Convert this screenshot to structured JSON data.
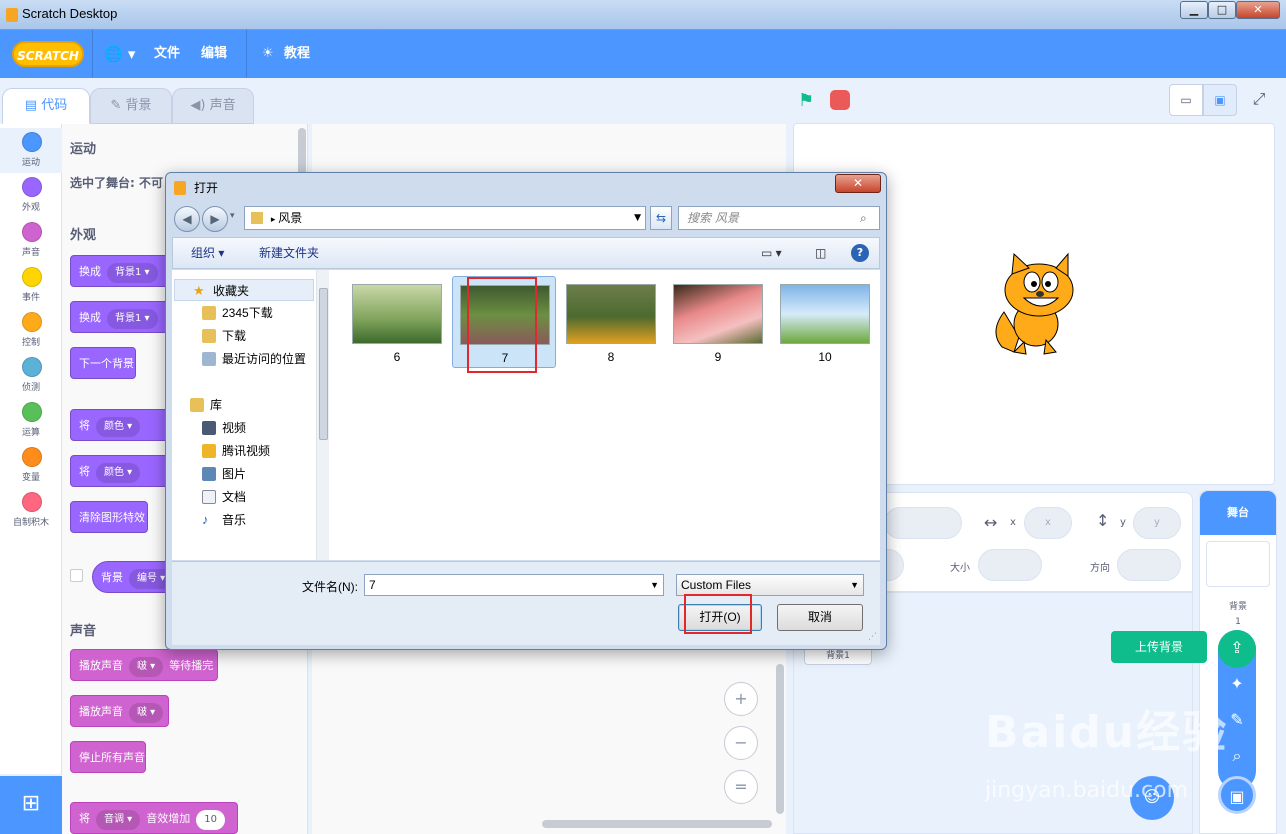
{
  "window": {
    "title": "Scratch Desktop",
    "minimize": "▁",
    "maximize": "□",
    "close": "✕"
  },
  "menubar": {
    "logo": "SCRATCH",
    "language": "🌐 ▾",
    "file": "文件",
    "edit": "编辑",
    "tutorials": "教程"
  },
  "tabs": [
    {
      "label": "代码",
      "icon": "code-icon"
    },
    {
      "label": "背景",
      "icon": "brush-icon"
    },
    {
      "label": "声音",
      "icon": "speaker-icon"
    }
  ],
  "categories": [
    {
      "label": "运动",
      "color": "#4c97ff"
    },
    {
      "label": "外观",
      "color": "#9966ff"
    },
    {
      "label": "声音",
      "color": "#cf63cf"
    },
    {
      "label": "事件",
      "color": "#ffd500"
    },
    {
      "label": "控制",
      "color": "#ffab19"
    },
    {
      "label": "侦测",
      "color": "#5cb1d6"
    },
    {
      "label": "运算",
      "color": "#59c059"
    },
    {
      "label": "变量",
      "color": "#ff8c1a"
    },
    {
      "label": "自制积木",
      "color": "#ff6680"
    }
  ],
  "palette": {
    "motion_head": "运动",
    "motion_note": "选中了舞台: 不可",
    "looks_head": "外观",
    "switch1": "换成",
    "switch1_val": "背景1 ▾",
    "switch2": "换成",
    "switch2_val": "背景1 ▾",
    "next_backdrop": "下一个背景",
    "set1": "将",
    "set1_val": "颜色 ▾",
    "set2": "将",
    "set2_val": "颜色 ▾",
    "clear_effects": "清除图形特效",
    "backdrop_rep": "背景",
    "backdrop_rep_val": "编号 ▾",
    "sound_head": "声音",
    "play_until": "播放声音",
    "play_until_val": "啵 ▾",
    "play_until_tail": "等待播完",
    "start_sound": "播放声音",
    "start_sound_val": "啵 ▾",
    "stop_all": "停止所有声音",
    "pitch": "将",
    "pitch_val": "音调 ▾",
    "pitch_tail": "音效增加",
    "pitch_num": "10"
  },
  "zoom": {
    "in": "+",
    "out": "−",
    "reset": "="
  },
  "sprite_info": {
    "x_label": "x",
    "x_ph": "x",
    "y_label": "y",
    "y_ph": "y",
    "size_label": "大小",
    "dir_label": "方向",
    "sprite_name": "背景1"
  },
  "stage_pane": {
    "title": "舞台",
    "backdrops_label": "背景",
    "backdrops_count": "1"
  },
  "upload_tip": "上传背景",
  "dialog": {
    "title": "打开",
    "close": "✕",
    "address": "风景",
    "search_placeholder": "搜索 风景",
    "organize": "组织 ▾",
    "new_folder": "新建文件夹",
    "nav": {
      "favorites": "收藏夹",
      "downloads_2345": "2345下载",
      "downloads": "下载",
      "recent": "最近访问的位置",
      "libraries": "库",
      "videos": "视频",
      "tencent_video": "腾讯视频",
      "pictures": "图片",
      "documents": "文档",
      "music": "音乐"
    },
    "files": [
      {
        "name": "6"
      },
      {
        "name": "7"
      },
      {
        "name": "8"
      },
      {
        "name": "9"
      },
      {
        "name": "10"
      }
    ],
    "filename_label": "文件名(N):",
    "filename_value": "7",
    "filter_value": "Custom Files",
    "open_button": "打开(O)",
    "cancel_button": "取消"
  },
  "watermark": {
    "brand": "Baidu经验",
    "url": "jingyan.baidu.com"
  }
}
